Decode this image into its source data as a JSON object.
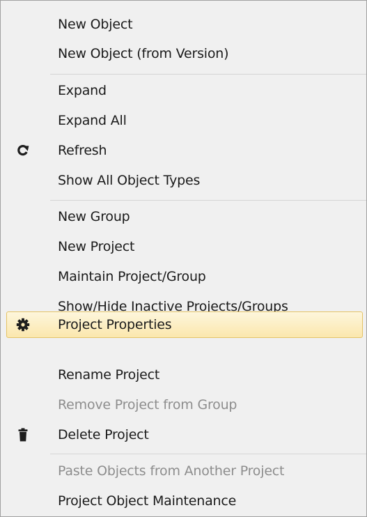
{
  "context_menu": {
    "items": [
      {
        "label": "New Object"
      },
      {
        "label": "New Object (from Version)"
      },
      {
        "label": "Expand"
      },
      {
        "label": "Expand All"
      },
      {
        "label": "Refresh",
        "icon": "refresh-icon"
      },
      {
        "label": "Show All Object Types"
      },
      {
        "label": "New Group"
      },
      {
        "label": "New Project"
      },
      {
        "label": "Maintain Project/Group"
      },
      {
        "label": "Show/Hide Inactive Projects/Groups"
      },
      {
        "label": "Project Properties",
        "icon": "gear-icon",
        "state": "highlighted"
      },
      {
        "label": "Rename Project"
      },
      {
        "label": "Remove Project from Group",
        "state": "disabled"
      },
      {
        "label": "Delete Project",
        "icon": "trash-icon"
      },
      {
        "label": "Paste Objects from Another Project",
        "state": "disabled"
      },
      {
        "label": "Project Object Maintenance"
      }
    ]
  },
  "colors": {
    "menu_background": "#f0f0f0",
    "highlight_fill": "#fbe7ad",
    "highlight_border": "#e5c365",
    "disabled_text": "#8d8d8d",
    "separator": "#d5d5d5"
  }
}
